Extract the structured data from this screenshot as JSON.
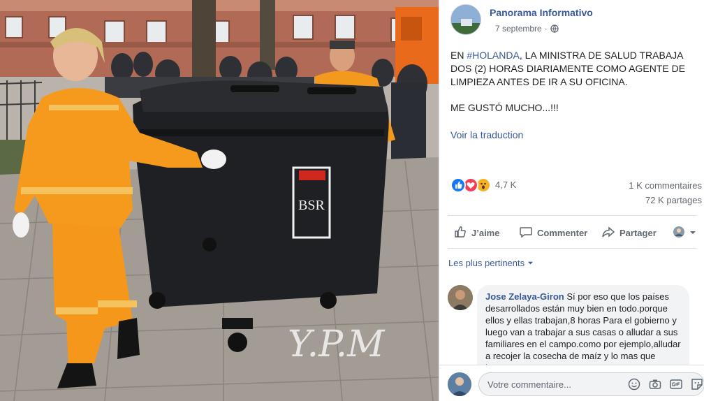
{
  "photo": {
    "watermark": "Y.P.M",
    "bin_logo": "BSR"
  },
  "post": {
    "page_name": "Panorama Informativo",
    "date": "7 septembre",
    "separator": "·",
    "text_prefix": "EN ",
    "hashtag": "#HOLANDA",
    "text_rest": ", LA MINISTRA DE SALUD TRABAJA DOS (2) HORAS DIARIAMENTE COMO AGENTE DE LIMPIEZA ANTES DE IR A SU OFICINA.",
    "text_second": "ME GUSTÓ MUCHO...!!!",
    "translate_label": "Voir la traduction"
  },
  "stats": {
    "reactions_count": "4,7 K",
    "comments": "1 K commentaires",
    "shares": "72 K partages",
    "reaction_icons": [
      "like-icon",
      "love-icon",
      "wow-icon"
    ]
  },
  "actions": {
    "like_label": "J’aime",
    "comment_label": "Commenter",
    "share_label": "Partager"
  },
  "comments": {
    "sort_label": "Les plus pertinents",
    "items": [
      {
        "author": "Jose Zelaya-Giron",
        "text": " Sí por eso que los países desarrollados están muy bien en todo.porque ellos y ellas trabajan,8 horas Para el gobierno y luego van a trabajar a sus casas o alludar a sus familiares en el campo.como por ejemplo,alludar a recojer la cosecha de maíz y lo mas que hagan"
      }
    ],
    "compose_placeholder": "Votre commentaire..."
  },
  "colors": {
    "link": "#385898",
    "like": "#1877f2",
    "love": "#f33e58",
    "wow": "#f7b125"
  }
}
